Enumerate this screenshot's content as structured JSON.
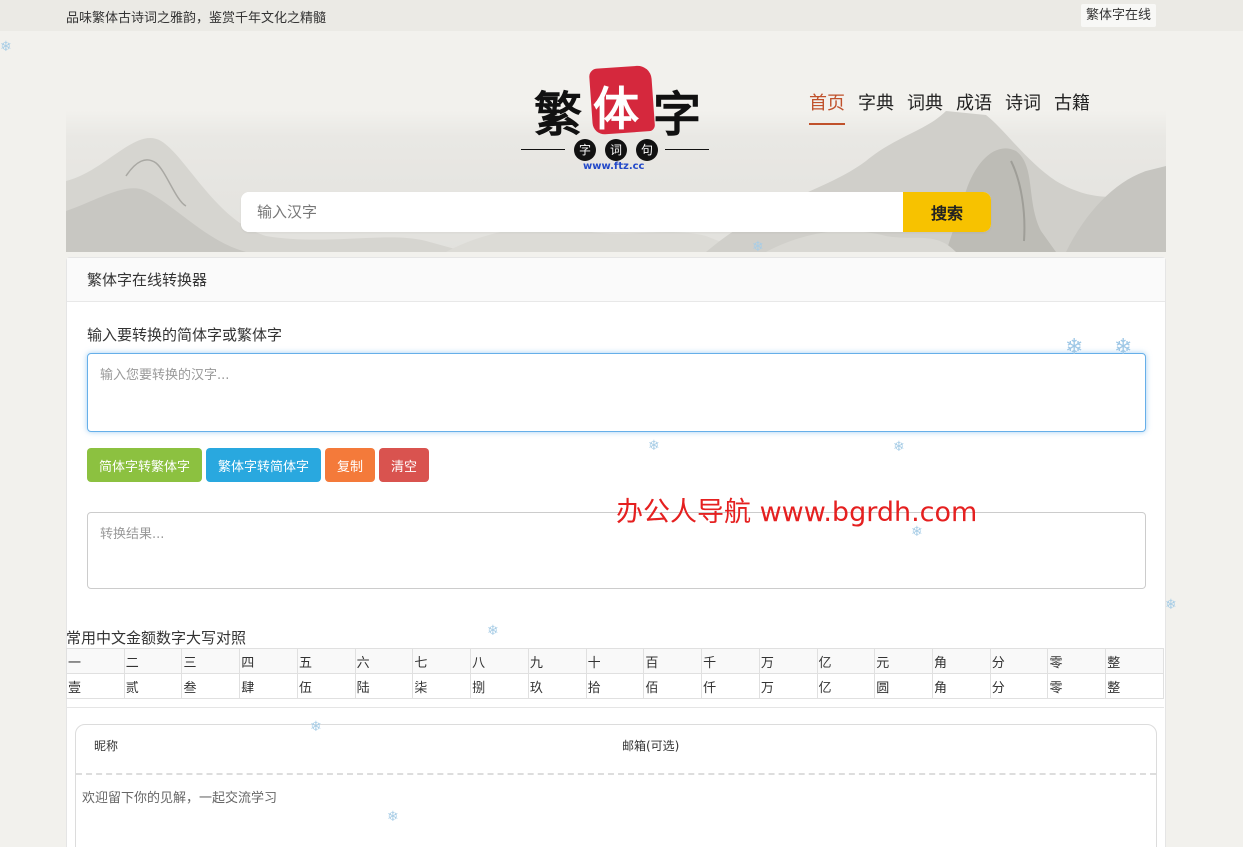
{
  "topbar": {
    "slogan": "品味繁体古诗词之雅韵，鉴赏千年文化之精髓",
    "site_link": "繁体字在线"
  },
  "logo": {
    "char1": "繁",
    "char2": "体",
    "char3": "字",
    "sub1": "字",
    "sub2": "词",
    "sub3": "句",
    "url": "www.ftz.cc"
  },
  "nav": {
    "items": [
      {
        "label": "首页",
        "active": true
      },
      {
        "label": "字典"
      },
      {
        "label": "词典"
      },
      {
        "label": "成语"
      },
      {
        "label": "诗词"
      },
      {
        "label": "古籍"
      }
    ]
  },
  "search": {
    "placeholder": "输入汉字",
    "button": "搜索"
  },
  "converter": {
    "title": "繁体字在线转换器",
    "input_label": "输入要转换的简体字或繁体字",
    "input_placeholder": "输入您要转换的汉字...",
    "buttons": {
      "s2t": "简体字转繁体字",
      "t2s": "繁体字转简体字",
      "copy": "复制",
      "clear": "清空"
    },
    "result_placeholder": "转换结果..."
  },
  "watermark": "办公人导航 www.bgrdh.com",
  "money": {
    "title": "常用中文金额数字大写对照",
    "row1": [
      "一",
      "二",
      "三",
      "四",
      "五",
      "六",
      "七",
      "八",
      "九",
      "十",
      "百",
      "千",
      "万",
      "亿",
      "元",
      "角",
      "分",
      "零",
      "整"
    ],
    "row2": [
      "壹",
      "贰",
      "叁",
      "肆",
      "伍",
      "陆",
      "柒",
      "捌",
      "玖",
      "拾",
      "佰",
      "仟",
      "万",
      "亿",
      "圆",
      "角",
      "分",
      "零",
      "整"
    ]
  },
  "comment": {
    "nick_label": "昵称",
    "email_label": "邮箱(可选)",
    "placeholder": "欢迎留下你的见解，一起交流学习"
  },
  "colors": {
    "accent_nav": "#c0512b",
    "search_button": "#f7c200",
    "btn_green": "#8cc140",
    "btn_blue": "#29a8df",
    "btn_orange": "#f47a3a",
    "btn_red": "#d9534f",
    "seal_red": "#d5283d",
    "watermark": "#e52020"
  }
}
